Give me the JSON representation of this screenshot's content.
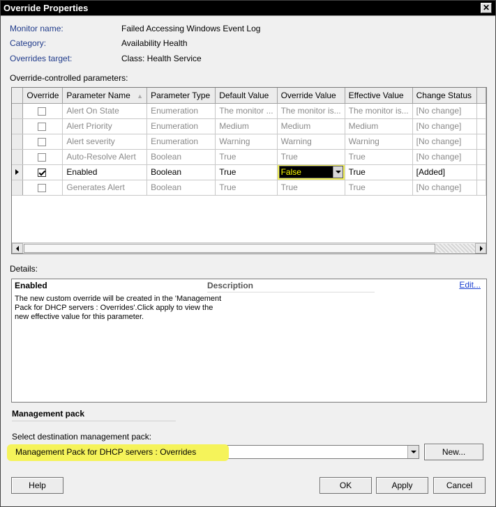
{
  "window": {
    "title": "Override Properties",
    "close_label": "✕"
  },
  "fields": {
    "monitor_name_label": "Monitor name:",
    "monitor_name_value": "Failed Accessing Windows Event Log",
    "category_label": "Category:",
    "category_value": "Availability Health",
    "target_label": "Overrides target:",
    "target_value": "Class: Health Service"
  },
  "grid": {
    "section_label": "Override-controlled parameters:",
    "columns": [
      "Override",
      "Parameter Name",
      "Parameter Type",
      "Default Value",
      "Override Value",
      "Effective Value",
      "Change Status"
    ],
    "rows": [
      {
        "checked": false,
        "name": "Alert On State",
        "type": "Enumeration",
        "default": "The monitor ...",
        "override": "The monitor is...",
        "effective": "The monitor is...",
        "status": "[No change]"
      },
      {
        "checked": false,
        "name": "Alert Priority",
        "type": "Enumeration",
        "default": "Medium",
        "override": "Medium",
        "effective": "Medium",
        "status": "[No change]"
      },
      {
        "checked": false,
        "name": "Alert severity",
        "type": "Enumeration",
        "default": "Warning",
        "override": "Warning",
        "effective": "Warning",
        "status": "[No change]"
      },
      {
        "checked": false,
        "name": "Auto-Resolve Alert",
        "type": "Boolean",
        "default": "True",
        "override": "True",
        "effective": "True",
        "status": "[No change]"
      },
      {
        "checked": true,
        "name": "Enabled",
        "type": "Boolean",
        "default": "True",
        "override": "False",
        "effective": "True",
        "status": "[Added]"
      },
      {
        "checked": false,
        "name": "Generates Alert",
        "type": "Boolean",
        "default": "True",
        "override": "True",
        "effective": "True",
        "status": "[No change]"
      }
    ]
  },
  "details": {
    "section_label": "Details:",
    "name": "Enabled",
    "description_header": "Description",
    "edit_link": "Edit...",
    "text": "The new custom override will be created in the 'Management Pack for DHCP servers : Overrides'.Click apply to view  the new effective value for this parameter."
  },
  "management_pack": {
    "title": "Management pack",
    "select_label": "Select destination management pack:",
    "selected": "Management Pack for DHCP servers : Overrides",
    "new_button": "New..."
  },
  "buttons": {
    "help": "Help",
    "ok": "OK",
    "apply": "Apply",
    "cancel": "Cancel"
  },
  "colors": {
    "highlight": "#f6f55a",
    "label_blue": "#1f3a8a",
    "link_blue": "#1a3fd0"
  }
}
